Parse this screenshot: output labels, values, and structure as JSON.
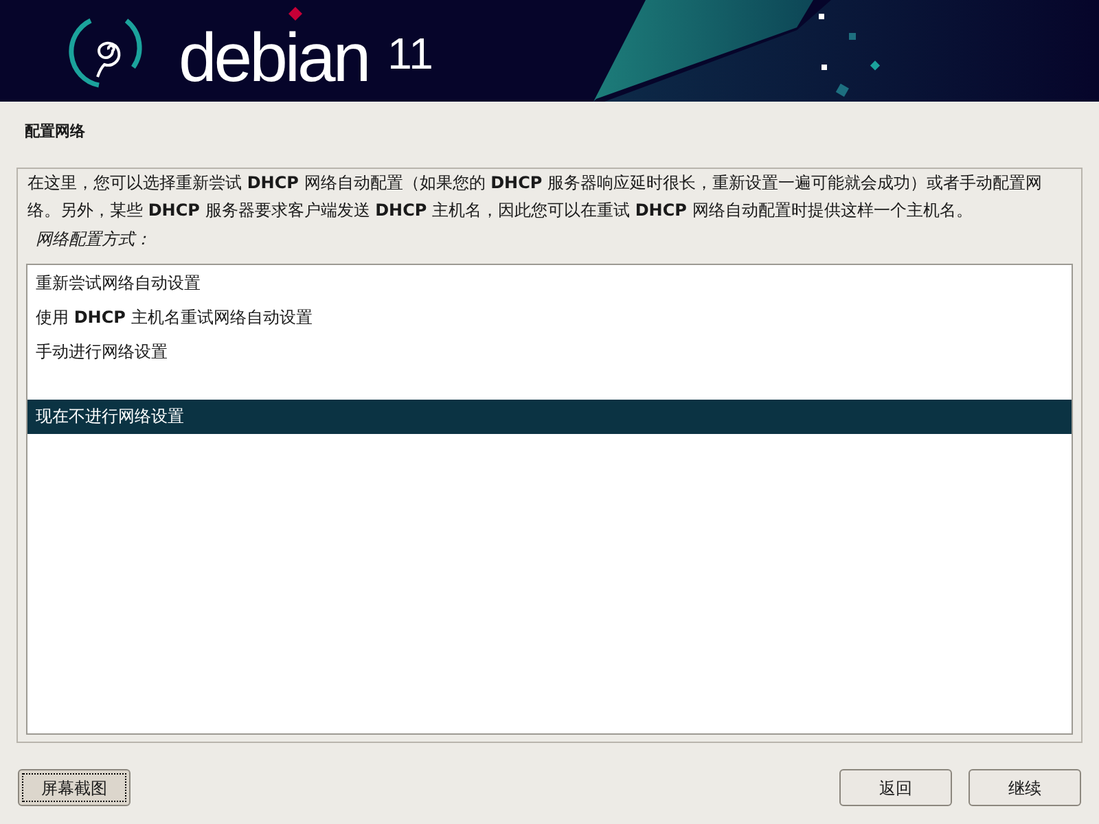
{
  "header": {
    "logo_text": "debian",
    "version": "11"
  },
  "page_title": "配置网络",
  "description": "在这里，您可以选择重新尝试 **DHCP** 网络自动配置（如果您的 **DHCP** 服务器响应延时很长，重新设置一遍可能就会成功）或者手动配置网络。另外，某些 **DHCP** 服务器要求客户端发送 **DHCP** 主机名，因此您可以在重试 **DHCP** 网络自动配置时提供这样一个主机名。",
  "prompt": "网络配置方式：",
  "option_groups": [
    {
      "options": [
        {
          "label": "重新尝试网络自动设置",
          "selected": false
        },
        {
          "label": "使用 **DHCP** 主机名重试网络自动设置",
          "selected": false
        },
        {
          "label": "手动进行网络设置",
          "selected": false
        }
      ]
    },
    {
      "options": [
        {
          "label": "现在不进行网络设置",
          "selected": true
        }
      ]
    }
  ],
  "screenshot_button": {
    "label": "屏幕截图",
    "focused": true
  },
  "nav_buttons": [
    {
      "label": "返回",
      "focused": false
    },
    {
      "label": "继续",
      "focused": false
    }
  ]
}
